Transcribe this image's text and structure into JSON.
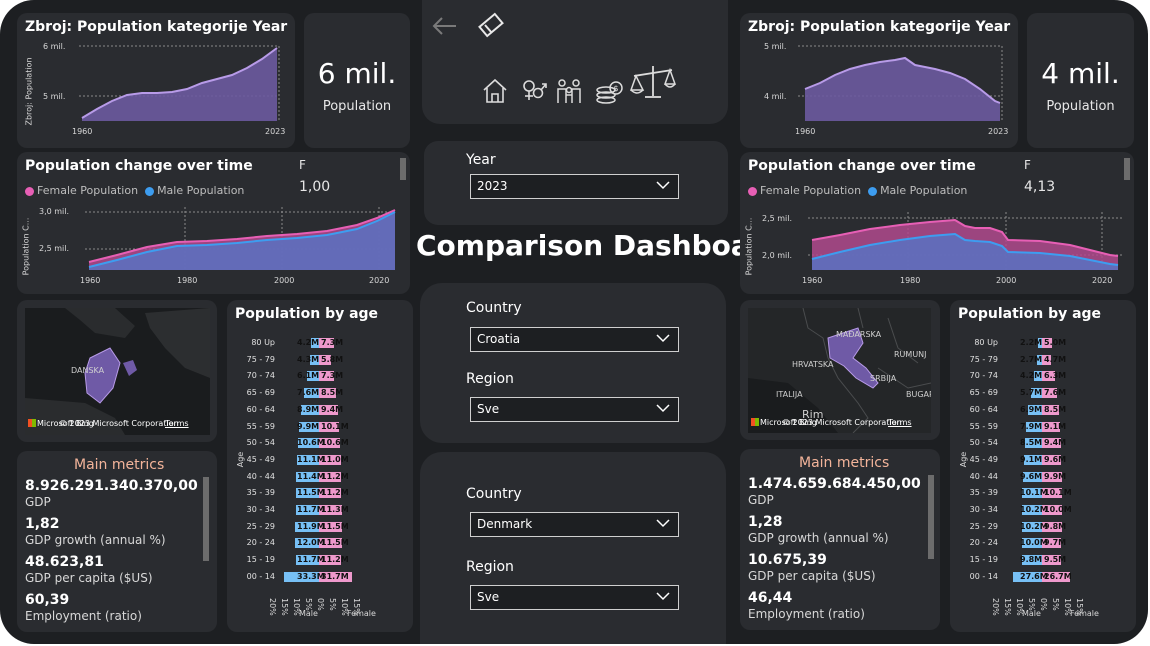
{
  "header": {
    "title": "Comparison Dashboard"
  },
  "toolbar": {
    "back_icon": "arrow-left-icon",
    "eraser_icon": "eraser-icon"
  },
  "nav_icons": [
    "home-icon",
    "gender-icon",
    "family-icon",
    "money-icon",
    "scales-icon"
  ],
  "year_filter": {
    "label": "Year",
    "value": "2023"
  },
  "filter_top": {
    "country_label": "Country",
    "country_value": "Croatia",
    "region_label": "Region",
    "region_value": "Sve"
  },
  "filter_bottom": {
    "country_label": "Country",
    "country_value": "Denmark",
    "region_label": "Region",
    "region_value": "Sve"
  },
  "colors": {
    "female": "#e75fb5",
    "male": "#3d9df0",
    "area": "#7d66b3",
    "line": "#b89be8",
    "bar_male": "#77c0f5",
    "bar_female": "#ee99cc"
  },
  "left": {
    "trend": {
      "title": "Zbroj: Population kategorije Year",
      "ylabel": "Zbroj: Population",
      "ticks": [
        "6 mil.",
        "5 mil."
      ],
      "x_start": "1960",
      "x_end": "2023"
    },
    "kpi": {
      "value": "6 mil.",
      "label": "Population"
    },
    "change": {
      "title": "Population change over time",
      "legend_female": "Female Population",
      "legend_male": "Male Population",
      "f_label": "F",
      "f_value": "1,00",
      "ylabel": "Population C...",
      "yticks": [
        "3,0 mil.",
        "2,5 mil."
      ],
      "xticks": [
        "1960",
        "1980",
        "2000",
        "2020"
      ]
    },
    "map": {
      "label": "DANSKA",
      "attribution": "© 2023 Microsoft Corporation",
      "terms": "Terms",
      "brand": "Microsoft Bing"
    },
    "metrics": {
      "title": "Main metrics",
      "items": [
        {
          "value": "8.926.291.340.370,00",
          "label": "GDP"
        },
        {
          "value": "1,82",
          "label": "GDP growth (annual %)"
        },
        {
          "value": "48.623,81",
          "label": "GDP per capita ($US)"
        },
        {
          "value": "60,39",
          "label": "Employment (ratio)"
        }
      ]
    },
    "pyramid": {
      "title": "Population by age",
      "axis_label": "Age",
      "male_label": "Male",
      "female_label": "Female",
      "ticks": [
        "20%",
        "15%",
        "10%",
        "5%",
        "0%",
        "5%",
        "10%",
        "15%"
      ],
      "rows": [
        {
          "age": "80 Up",
          "male": "4.2M",
          "female": "7.3M"
        },
        {
          "age": "75 - 79",
          "male": "4.3M",
          "female": "5.8M"
        },
        {
          "age": "70 - 74",
          "male": "6.1M",
          "female": "7.3M"
        },
        {
          "age": "65 - 69",
          "male": "7.6M",
          "female": "8.5M"
        },
        {
          "age": "60 - 64",
          "male": "8.9M",
          "female": "9.4M"
        },
        {
          "age": "55 - 59",
          "male": "9.9M",
          "female": "10.1M"
        },
        {
          "age": "50 - 54",
          "male": "10.6M",
          "female": "10.6M"
        },
        {
          "age": "45 - 49",
          "male": "11.1M",
          "female": "11.0M"
        },
        {
          "age": "40 - 44",
          "male": "11.4M",
          "female": "11.2M"
        },
        {
          "age": "35 - 39",
          "male": "11.5M",
          "female": "11.2M"
        },
        {
          "age": "30 - 34",
          "male": "11.7M",
          "female": "11.3M"
        },
        {
          "age": "25 - 29",
          "male": "11.9M",
          "female": "11.5M"
        },
        {
          "age": "20 - 24",
          "male": "12.0M",
          "female": "11.5M"
        },
        {
          "age": "15 - 19",
          "male": "11.7M",
          "female": "11.2M"
        },
        {
          "age": "00 - 14",
          "male": "33.3M",
          "female": "31.7M"
        }
      ]
    }
  },
  "right": {
    "trend": {
      "title": "Zbroj: Population kategorije Year",
      "ticks": [
        "5 mil.",
        "4 mil."
      ],
      "x_start": "1960",
      "x_end": "2023"
    },
    "kpi": {
      "value": "4 mil.",
      "label": "Population"
    },
    "change": {
      "title": "Population change over time",
      "legend_female": "Female Population",
      "legend_male": "Male Population",
      "f_label": "F",
      "f_value": "4,13",
      "ylabel": "Population C...",
      "yticks": [
        "2,5 mil.",
        "2,0 mil."
      ],
      "xticks": [
        "1960",
        "1980",
        "2000",
        "2020"
      ]
    },
    "map": {
      "labels": [
        "MAĐARSKA",
        "RUMUNJ",
        "HRVATSKA",
        "SRBIJA",
        "BUGAR",
        "ITALIJA",
        "Rim"
      ],
      "attribution": "© 2023 Microsoft Corporation",
      "terms": "Terms",
      "brand": "Microsoft Bing"
    },
    "metrics": {
      "title": "Main metrics",
      "items": [
        {
          "value": "1.474.659.684.450,00",
          "label": "GDP"
        },
        {
          "value": "1,28",
          "label": "GDP growth (annual %)"
        },
        {
          "value": "10.675,39",
          "label": "GDP per capita ($US)"
        },
        {
          "value": "46,44",
          "label": "Employment (ratio)"
        }
      ]
    },
    "pyramid": {
      "title": "Population by age",
      "axis_label": "Age",
      "male_label": "Male",
      "female_label": "Female",
      "ticks": [
        "20%",
        "15%",
        "10%",
        "5%",
        "0%",
        "5%",
        "10%",
        "15%"
      ],
      "rows": [
        {
          "age": "80 Up",
          "male": "2.2M",
          "female": "5.0M"
        },
        {
          "age": "75 - 79",
          "male": "2.7M",
          "female": "4.7M"
        },
        {
          "age": "70 - 74",
          "male": "4.2M",
          "female": "6.3M"
        },
        {
          "age": "65 - 69",
          "male": "5.7M",
          "female": "7.6M"
        },
        {
          "age": "60 - 64",
          "male": "6.9M",
          "female": "8.5M"
        },
        {
          "age": "55 - 59",
          "male": "7.9M",
          "female": "9.1M"
        },
        {
          "age": "50 - 54",
          "male": "8.5M",
          "female": "9.4M"
        },
        {
          "age": "45 - 49",
          "male": "9.1M",
          "female": "9.6M"
        },
        {
          "age": "40 - 44",
          "male": "9.6M",
          "female": "9.9M"
        },
        {
          "age": "35 - 39",
          "male": "10.1M",
          "female": "10.1M"
        },
        {
          "age": "30 - 34",
          "male": "10.2M",
          "female": "10.0M"
        },
        {
          "age": "25 - 29",
          "male": "10.2M",
          "female": "9.8M"
        },
        {
          "age": "20 - 24",
          "male": "10.0M",
          "female": "9.7M"
        },
        {
          "age": "15 - 19",
          "male": "9.8M",
          "female": "9.5M"
        },
        {
          "age": "00 - 14",
          "male": "27.6M",
          "female": "26.7M"
        }
      ]
    }
  }
}
